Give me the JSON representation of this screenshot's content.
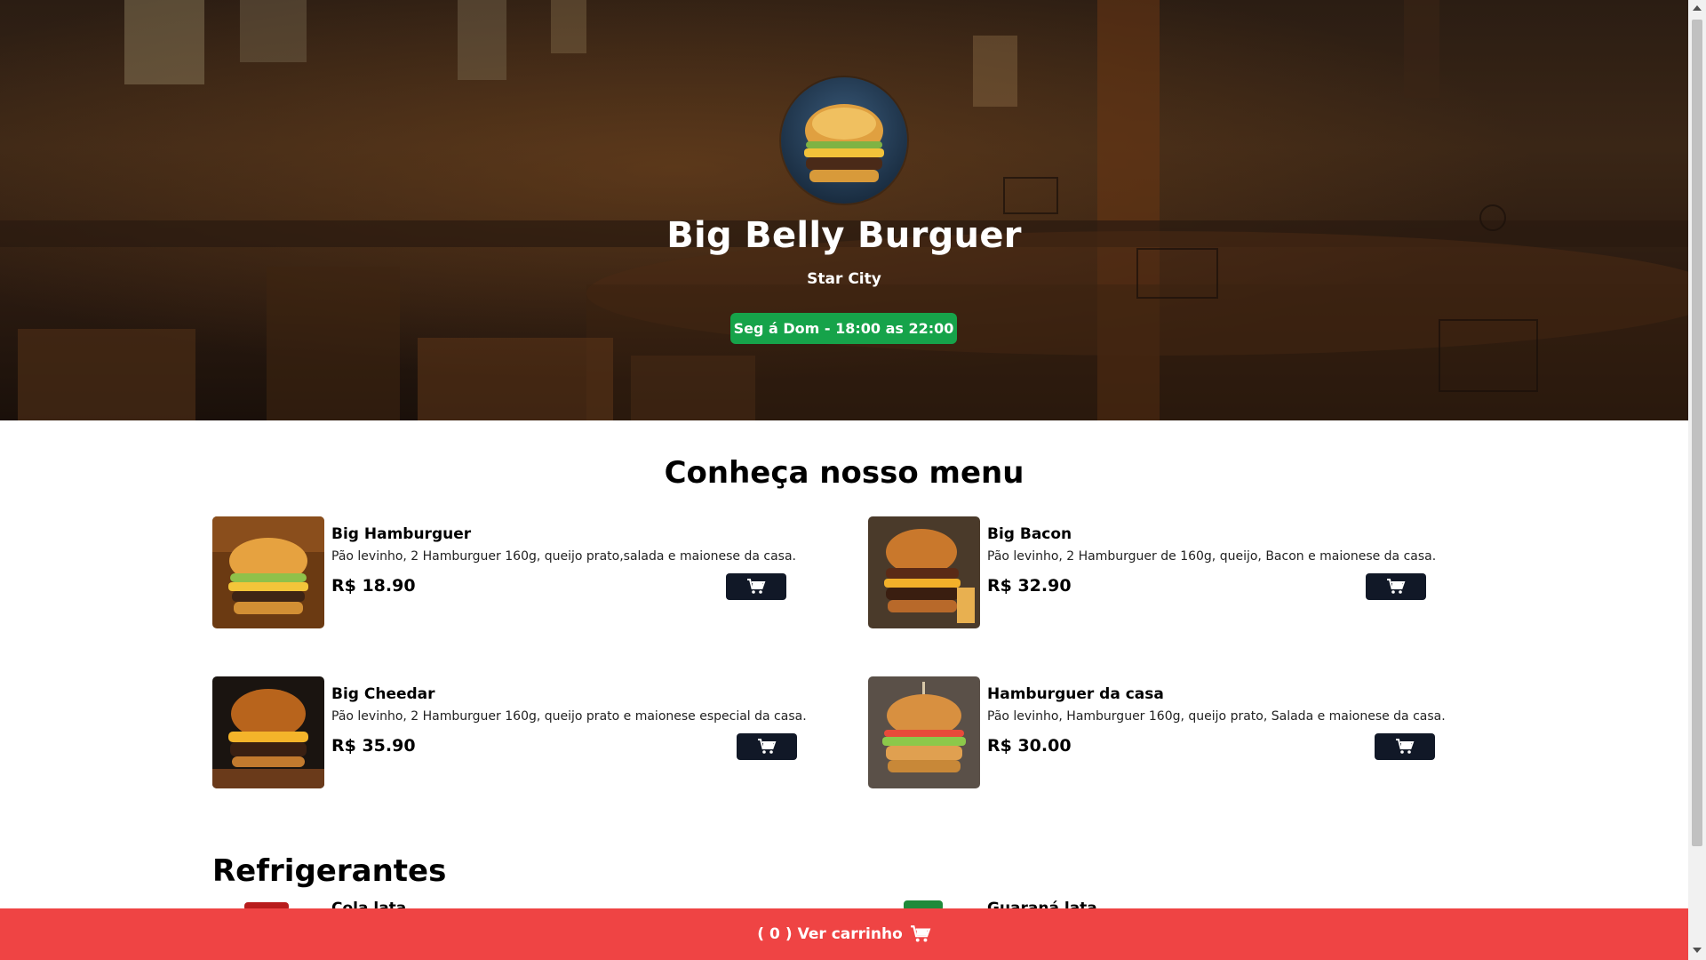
{
  "hero": {
    "title": "Big Belly Burguer",
    "city": "Star City",
    "hours": "Seg á Dom - 18:00 as 22:00"
  },
  "menu": {
    "title": "Conheça nosso menu",
    "items": [
      {
        "name": "Big Hamburguer",
        "description": "Pão levinho, 2 Hamburguer 160g, queijo prato,salada e maionese da casa.",
        "price": "R$ 18.90"
      },
      {
        "name": "Big Bacon",
        "description": "Pão levinho, 2 Hamburguer de 160g, queijo, Bacon e maionese da casa.",
        "price": "R$ 32.90"
      },
      {
        "name": "Big Cheedar",
        "description": "Pão levinho, 2 Hamburguer 160g, queijo prato e maionese especial da casa.",
        "price": "R$ 35.90"
      },
      {
        "name": "Hamburguer da casa",
        "description": "Pão levinho, Hamburguer 160g, queijo prato, Salada e maionese da casa.",
        "price": "R$ 30.00"
      }
    ]
  },
  "drinks": {
    "title": "Refrigerantes",
    "items": [
      {
        "name": "Cola lata"
      },
      {
        "name": "Guaraná lata"
      }
    ]
  },
  "cart_bar": {
    "open_paren": "(",
    "count": "0",
    "close_paren": ")",
    "label": "Ver carrinho",
    "icon": "cart-icon"
  },
  "colors": {
    "accent_green": "#16a34a",
    "cart_bar_red": "#ef4444",
    "button_dark": "#111827"
  }
}
